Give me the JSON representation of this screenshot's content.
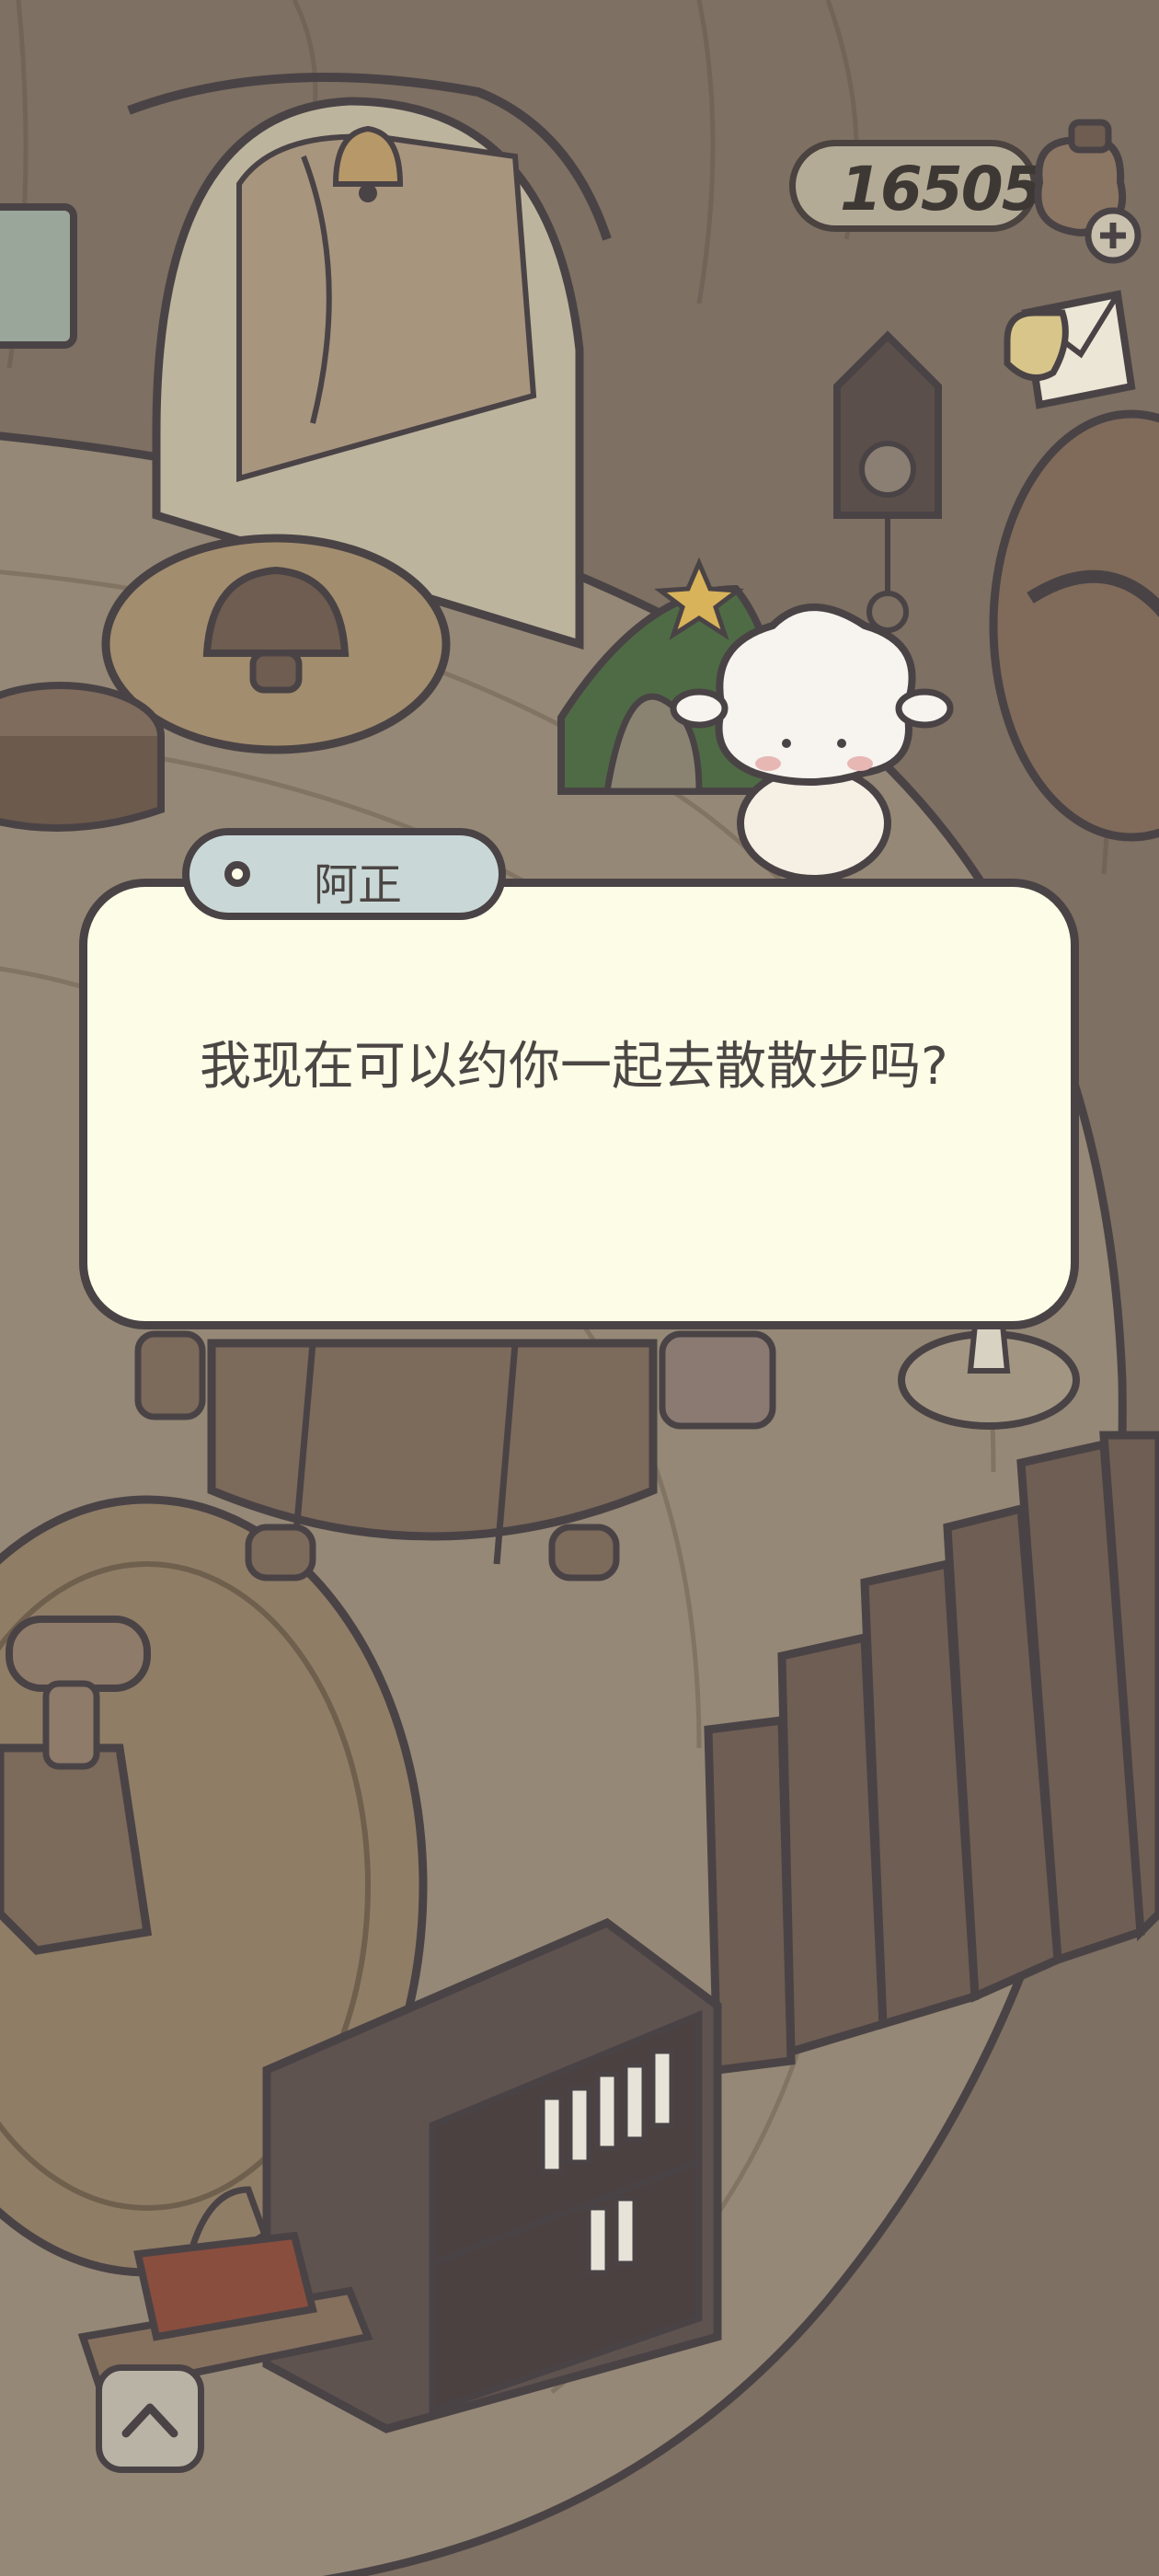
{
  "hud": {
    "coins": "16505",
    "coin_bag_icon": "coin-bag-with-plus-icon",
    "mail_icon": "mail-letter-icon"
  },
  "dialog": {
    "speaker": "阿正",
    "text": "我现在可以约你一起去散散步吗?"
  },
  "controls": {
    "expand_icon": "chevron-up-icon"
  },
  "colors": {
    "background": "#7c6e60",
    "dialog_bg": "#fdfce6",
    "outline": "#4a4346",
    "tag_bg": "#c9d8d7",
    "coin_pill": "#b4ab97"
  }
}
